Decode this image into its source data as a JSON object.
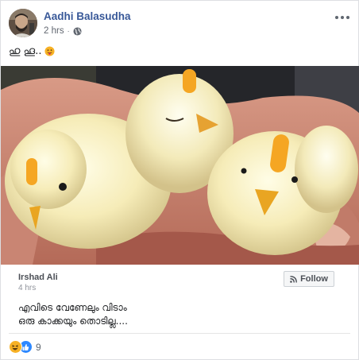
{
  "post": {
    "author": "Aadhi Balasudha",
    "timestamp": "2 hrs",
    "privacy_icon": "globe-icon",
    "text": "ഹു ഹൂ..",
    "text_emoji": "stuck-out-tongue-emoji"
  },
  "photo": {
    "subject": "chicks-in-hand"
  },
  "shared": {
    "name": "Irshad Ali",
    "timestamp": "4 hrs",
    "follow_label": "Follow",
    "line1": "എവിടെ വേണേലും വിടാം",
    "line2": "ഒരു കാക്കയും തൊടില്ല...."
  },
  "reactions": {
    "types": [
      "haha",
      "like"
    ],
    "count": "9"
  },
  "colors": {
    "author_blue": "#385898",
    "haha_yellow": "#f7b125",
    "like_blue": "#2d88ff",
    "censor_orange": "#f5a623"
  }
}
